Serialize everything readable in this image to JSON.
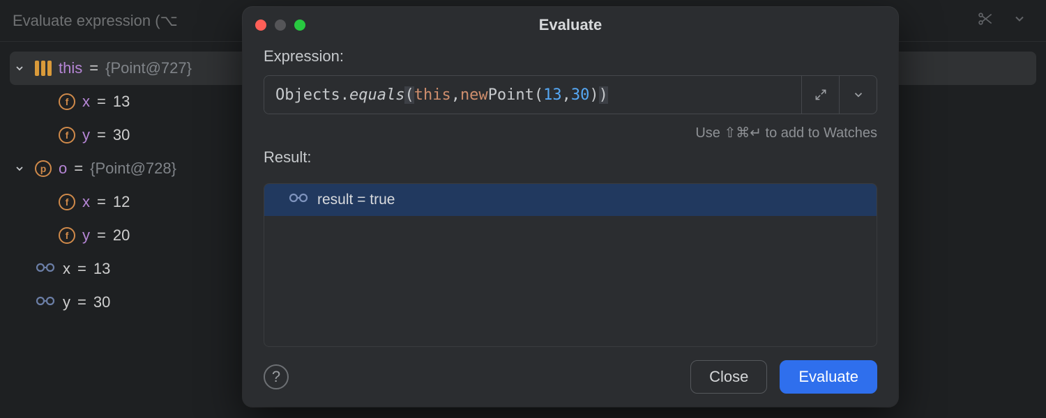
{
  "bg": {
    "header_placeholder": "Evaluate expression (⌥",
    "tree": {
      "this_row": {
        "name": "this",
        "value": "{Point@727}"
      },
      "this_children": [
        {
          "name": "x",
          "value": "13"
        },
        {
          "name": "y",
          "value": "30"
        }
      ],
      "o_row": {
        "name": "o",
        "value": "{Point@728}"
      },
      "o_children": [
        {
          "name": "x",
          "value": "12"
        },
        {
          "name": "y",
          "value": "20"
        }
      ],
      "watches": [
        {
          "name": "x",
          "value": "13"
        },
        {
          "name": "y",
          "value": "30"
        }
      ]
    }
  },
  "dialog": {
    "title": "Evaluate",
    "expression_label": "Expression:",
    "expression_tokens": {
      "t1": "Objects.",
      "t2": "equals",
      "t3": "(",
      "t4": "this",
      "t5": ", ",
      "t6": "new",
      "t7": " Point(",
      "t8": "13",
      "t9": ", ",
      "t10": "30",
      "t11": ")",
      "t12": ")"
    },
    "hint": "Use ⇧⌘↵ to add to Watches",
    "result_label": "Result:",
    "result_text": "result = true",
    "close_label": "Close",
    "evaluate_label": "Evaluate",
    "help_label": "?"
  }
}
